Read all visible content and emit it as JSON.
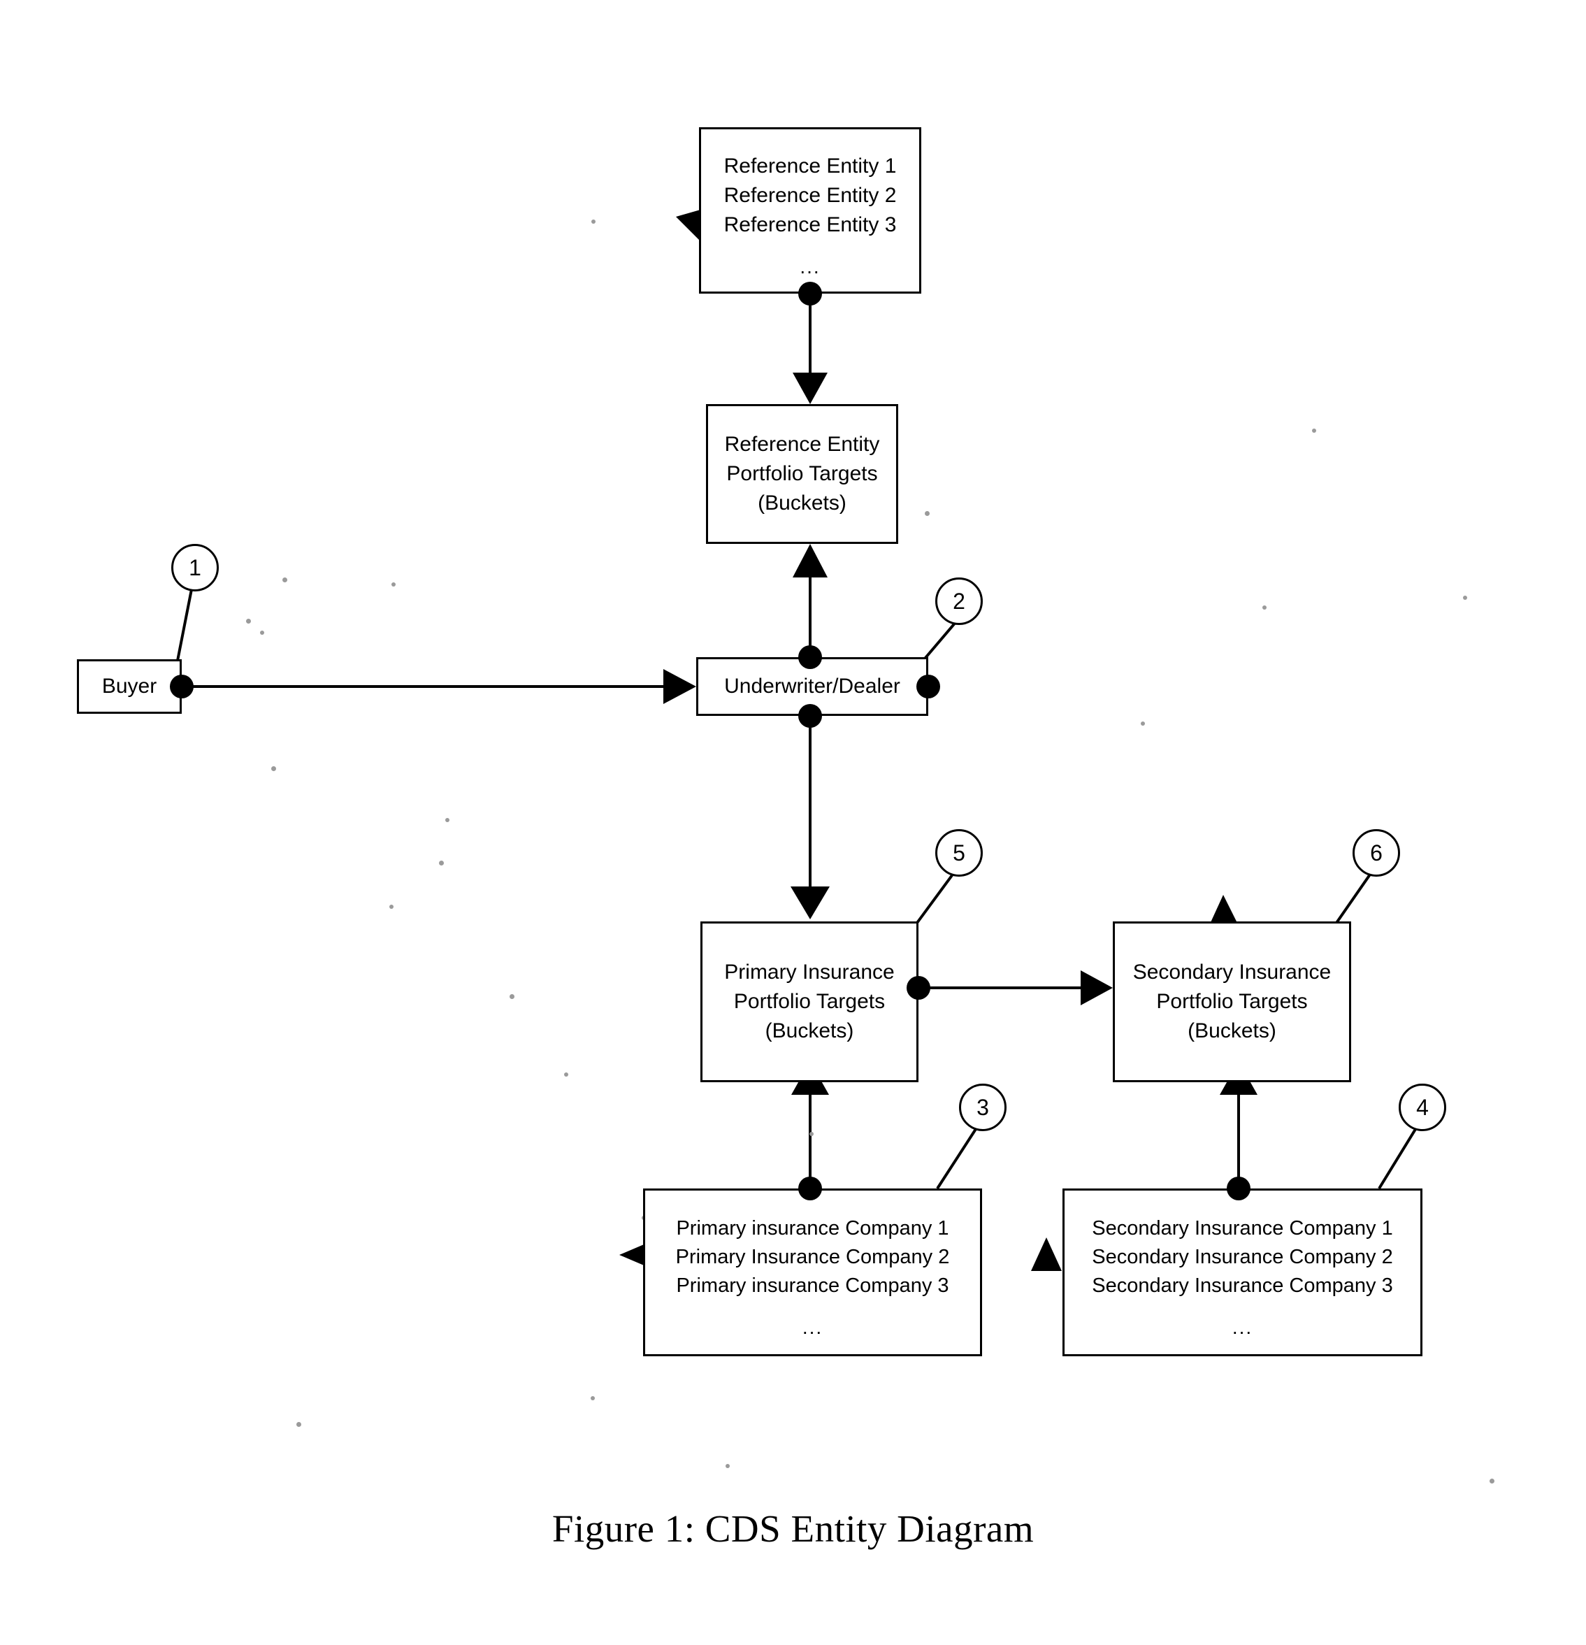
{
  "figure": {
    "caption": "Figure 1: CDS Entity Diagram",
    "title": "CDS Entity Diagram"
  },
  "nodes": {
    "reference_entities": {
      "id": "reference-entities",
      "lines": [
        "Reference Entity 1",
        "Reference Entity 2",
        "Reference Entity 3"
      ],
      "ellipsis": "..."
    },
    "reference_entity_portfolio_targets": {
      "id": "reference-entity-portfolio-targets",
      "lines": [
        "Reference Entity",
        "Portfolio Targets",
        "(Buckets)"
      ]
    },
    "buyer": {
      "id": "buyer",
      "label": "Buyer",
      "callout": "1"
    },
    "underwriter_dealer": {
      "id": "underwriter-dealer",
      "label": "Underwriter/Dealer",
      "callout": "2"
    },
    "primary_insurance_portfolio_targets": {
      "id": "primary-insurance-portfolio-targets",
      "lines": [
        "Primary Insurance",
        "Portfolio Targets",
        "(Buckets)"
      ],
      "callout": "5"
    },
    "secondary_insurance_portfolio_targets": {
      "id": "secondary-insurance-portfolio-targets",
      "lines": [
        "Secondary Insurance",
        "Portfolio Targets",
        "(Buckets)"
      ],
      "callout": "6"
    },
    "primary_insurance_companies": {
      "id": "primary-insurance-companies",
      "lines": [
        "Primary insurance Company 1",
        "Primary Insurance Company 2",
        "Primary insurance Company 3"
      ],
      "ellipsis": "...",
      "callout": "3"
    },
    "secondary_insurance_companies": {
      "id": "secondary-insurance-companies",
      "lines": [
        "Secondary Insurance Company 1",
        "Secondary Insurance Company 2",
        "Secondary Insurance Company 3"
      ],
      "ellipsis": "...",
      "callout": "4"
    }
  },
  "callouts": [
    {
      "number": "1",
      "target": "buyer"
    },
    {
      "number": "2",
      "target": "underwriter-dealer"
    },
    {
      "number": "3",
      "target": "primary-insurance-companies"
    },
    {
      "number": "4",
      "target": "secondary-insurance-companies"
    },
    {
      "number": "5",
      "target": "primary-insurance-portfolio-targets"
    },
    {
      "number": "6",
      "target": "secondary-insurance-portfolio-targets"
    }
  ],
  "edges": [
    {
      "from": "reference-entities",
      "to": "reference-entity-portfolio-targets",
      "direction": "down"
    },
    {
      "from": "underwriter-dealer",
      "to": "reference-entity-portfolio-targets",
      "direction": "up"
    },
    {
      "from": "buyer",
      "to": "underwriter-dealer",
      "direction": "right"
    },
    {
      "from": "underwriter-dealer",
      "to": "primary-insurance-portfolio-targets",
      "direction": "down"
    },
    {
      "from": "primary-insurance-portfolio-targets",
      "to": "secondary-insurance-portfolio-targets",
      "direction": "right"
    },
    {
      "from": "primary-insurance-companies",
      "to": "primary-insurance-portfolio-targets",
      "direction": "up"
    },
    {
      "from": "secondary-insurance-companies",
      "to": "secondary-insurance-portfolio-targets",
      "direction": "up"
    }
  ],
  "colors": {
    "stroke": "#000000",
    "fill": "#ffffff",
    "text": "#000000"
  }
}
